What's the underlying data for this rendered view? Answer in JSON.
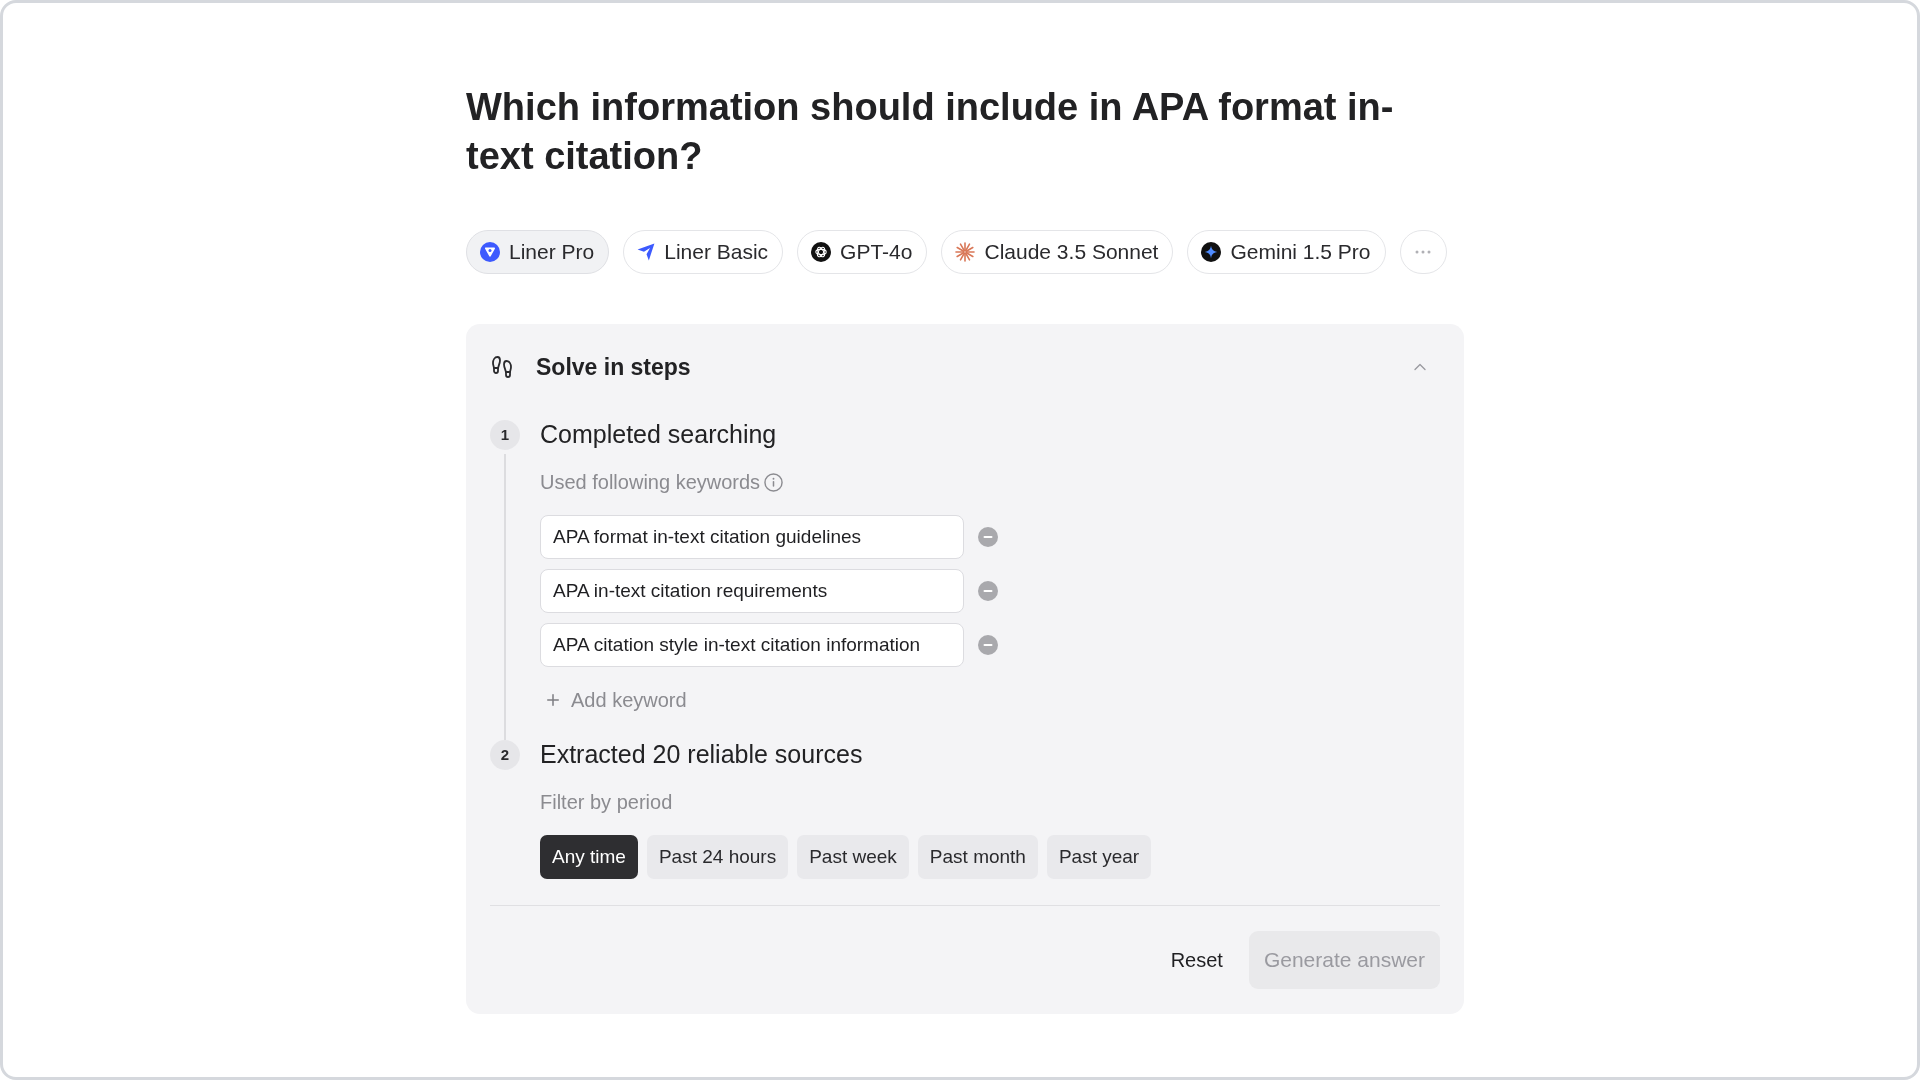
{
  "question": {
    "title": "Which information should include in APA format in-text citation?"
  },
  "models": [
    {
      "name": "Liner Pro",
      "kind": "shield",
      "selected": true
    },
    {
      "name": "Liner Basic",
      "kind": "plane",
      "selected": false
    },
    {
      "name": "GPT-4o",
      "kind": "knot",
      "selected": false
    },
    {
      "name": "Claude 3.5 Sonnet",
      "kind": "starburst",
      "selected": false
    },
    {
      "name": "Gemini 1.5 Pro",
      "kind": "sparkle",
      "selected": false
    }
  ],
  "steps_panel": {
    "title": "Solve in steps",
    "expanded": true,
    "steps": [
      {
        "number": "1",
        "title": "Completed searching",
        "kind": "keywords",
        "label": "Used following keywords",
        "keywords": [
          "APA format in-text citation guidelines",
          "APA in-text citation requirements",
          "APA citation style in-text citation information"
        ],
        "add_label": "Add keyword"
      },
      {
        "number": "2",
        "title": "Extracted 20 reliable sources",
        "kind": "filter",
        "label": "Filter by period",
        "periods": [
          {
            "label": "Any time",
            "selected": true
          },
          {
            "label": "Past 24 hours",
            "selected": false
          },
          {
            "label": "Past week",
            "selected": false
          },
          {
            "label": "Past month",
            "selected": false
          },
          {
            "label": "Past year",
            "selected": false
          }
        ]
      }
    ]
  },
  "actions": {
    "reset": "Reset",
    "generate": {
      "label": "Generate answer",
      "disabled": true
    }
  }
}
